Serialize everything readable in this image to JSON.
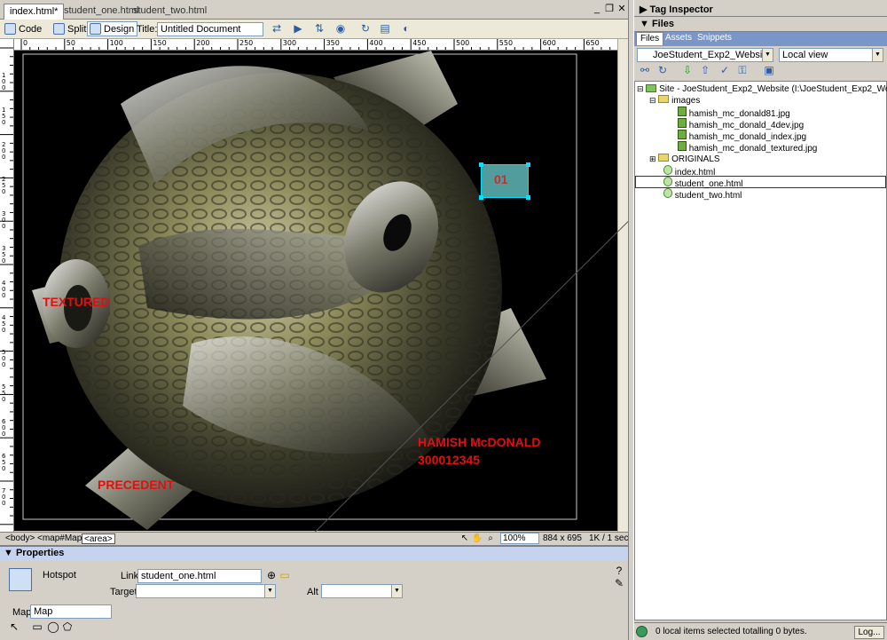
{
  "doc_tabs": [
    {
      "label": "index.html*",
      "active": true
    },
    {
      "label": "student_one.html",
      "active": false
    },
    {
      "label": "student_two.html",
      "active": false
    }
  ],
  "toolbar": {
    "code_label": "Code",
    "split_label": "Split",
    "design_label": "Design",
    "title_label": "Title:",
    "title_value": "Untitled Document"
  },
  "hruler_ticks": [
    "0",
    "50",
    "100",
    "150",
    "200",
    "250",
    "300",
    "350",
    "400",
    "450",
    "500",
    "550",
    "600",
    "650"
  ],
  "vruler_ticks": [
    "1 0 0",
    "1 5 0",
    "2 0 0",
    "2 5 0",
    "3 0 0",
    "3 5 0",
    "4 0 0",
    "4 5 0",
    "5 0 0",
    "5 5 0",
    "6 0 0",
    "6 5 0",
    "7 0 0"
  ],
  "canvas": {
    "hotspot_label": "01",
    "text_textured": "TEXTURED",
    "text_precedent": "PRECEDENT",
    "text_name": "HAMISH McDONALD",
    "text_id": "300012345"
  },
  "status_bar": {
    "tags": [
      "<body>",
      "<map#Map>",
      "<area>"
    ],
    "zoom": "100%",
    "size": "884 x 695",
    "weight": "1K / 1 sec"
  },
  "properties": {
    "title": "Properties",
    "type_label": "Hotspot",
    "link_label": "Link",
    "link_value": "student_one.html",
    "target_label": "Target",
    "target_value": "",
    "alt_label": "Alt",
    "alt_value": "",
    "map_label": "Map",
    "map_value": "Map"
  },
  "panels": {
    "tag_inspector": "Tag Inspector",
    "files": "Files",
    "tabs": [
      "Files",
      "Assets",
      "Snippets"
    ],
    "site_select": "JoeStudent_Exp2_Website",
    "view_select": "Local view"
  },
  "tree": {
    "root": "Site - JoeStudent_Exp2_Website (I:\\JoeStudent_Exp2_Website)",
    "images_folder": "images",
    "images": [
      "hamish_mc_donald81.jpg",
      "hamish_mc_donald_4dev.jpg",
      "hamish_mc_donald_index.jpg",
      "hamish_mc_donald_textured.jpg"
    ],
    "originals_folder": "ORIGINALS",
    "files": [
      "index.html",
      "student_one.html",
      "student_two.html"
    ]
  },
  "files_status": {
    "text": "0 local items selected totalling 0 bytes.",
    "log_button": "Log..."
  },
  "colors": {
    "red_text": "#e01010",
    "hotspot_fill": "#5fb7b7",
    "hotspot_handle": "#00e0ff"
  }
}
